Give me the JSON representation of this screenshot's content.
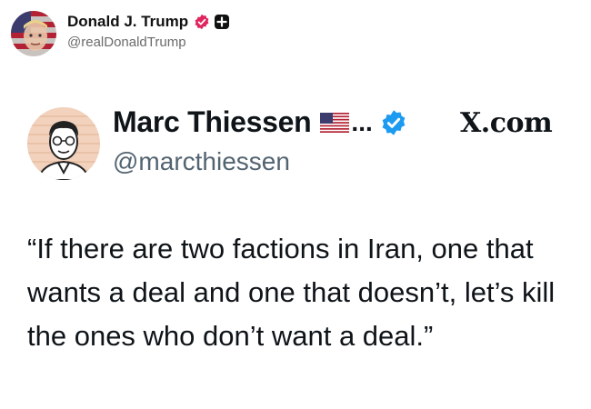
{
  "post": {
    "author_name": "Donald J. Trump",
    "author_handle": "@realDonaldTrump"
  },
  "embedded": {
    "author_name": "Marc Thiessen",
    "ellipsis": "...",
    "author_handle": "@marcthiessen",
    "site_label": "X.com",
    "text": "“If there are two factions in Iran, one that wants a deal and one that doesn’t, let’s kill the ones who don’t want a deal.”"
  },
  "colors": {
    "verified_blue": "#1d9bf0",
    "badge_pink": "#e0245e",
    "handle_gray": "#536471"
  },
  "icons": {
    "outer_badge": "verified-badge-icon",
    "outer_plus": "plus-icon",
    "flag": "us-flag-icon",
    "inner_verified": "verified-check-icon"
  }
}
